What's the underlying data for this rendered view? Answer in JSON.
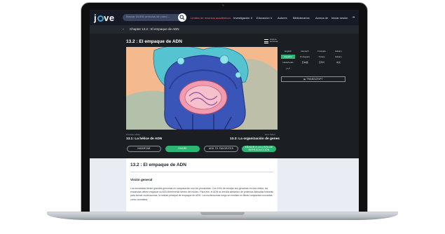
{
  "nav": {
    "logo": "jove",
    "search_placeholder": "Buscar 16.550 artículos de vídeo...",
    "links": [
      "Límites de recursos académicos",
      "Investigación ∨",
      "Educación ∨",
      "Autores",
      "Bibliotecarios",
      "Acerca de",
      "Iniciar sesión"
    ],
    "lang_button": "ES"
  },
  "breadcrumb": {
    "back": "‹",
    "text": "Chapter 13.2 : El empaque de ADN"
  },
  "video": {
    "title": "13.2 : El empaque de ADN",
    "list_label": "Lista de lecciones"
  },
  "languages": [
    "English",
    "Deutsch",
    "Français",
    "Italiano",
    "Español",
    "Português",
    "Türkçe",
    "Italiano",
    "Nederlands",
    "日本語",
    "한국어",
    "中文",
    "عربي"
  ],
  "active_language": "Español",
  "transcript_button": "TRANSCRIPT",
  "previous": {
    "label": "Previous Video",
    "title": "13.1: La hélice de ADN"
  },
  "next": {
    "label": "Next Video",
    "title": "13.3: La organización de genes"
  },
  "actions": [
    "INSERTAR",
    "SHARE",
    "ADD TO FAVORITES",
    "AÑADIR A LA LISTA DE REPRODUCCIÓN"
  ],
  "article": {
    "title": "13.2 : El empaque de ADN",
    "section": "Visión general",
    "body": "Los eucariotas tienen grandes genomas en comparación con los procariotas. Con el fin de encajar sus genomas en una célula, los eucariotas deben empacar su ADN firmemente dentro del núcleo. Para ello, el ADN se enrolla alrededor de proteínas llamadas histonas para formar nucleosomas, la unidad principal de empaque de ADN. Los nucleosomas luego se enrollan en fibras compactas conocidas como cromatina."
  }
}
